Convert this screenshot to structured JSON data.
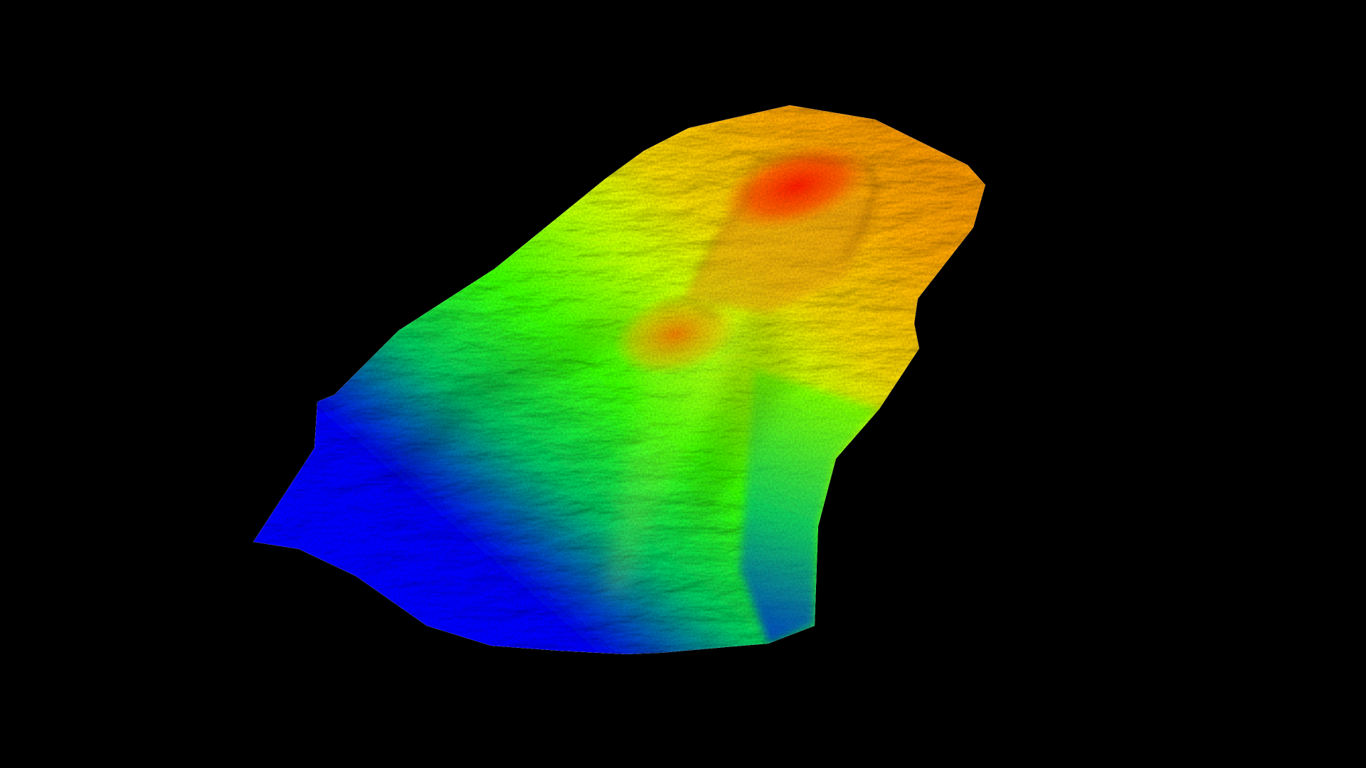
{
  "scene": {
    "background_color": "#000000",
    "colormap": {
      "low": "#0000ff",
      "low_mid": "#00c060",
      "mid": "#3cff00",
      "high_mid": "#e8d000",
      "high": "#ff1a00"
    },
    "shading": "hillshade"
  }
}
